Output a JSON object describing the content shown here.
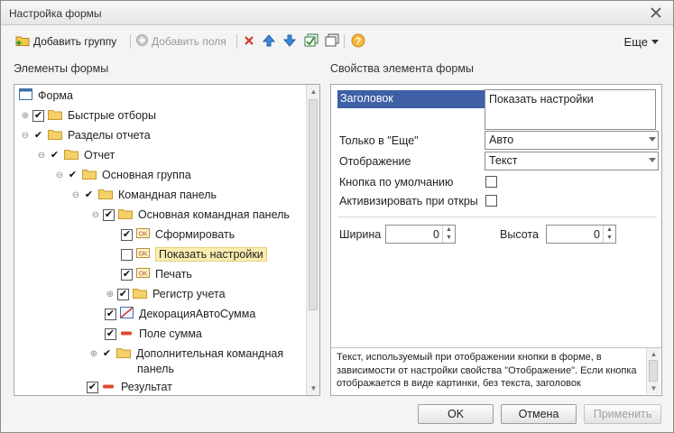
{
  "window": {
    "title": "Настройка формы"
  },
  "toolbar": {
    "add_group": "Добавить группу",
    "add_fields": "Добавить поля",
    "more": "Еще"
  },
  "left_panel": {
    "title": "Элементы формы"
  },
  "right_panel": {
    "title": "Свойства элемента формы"
  },
  "tree": {
    "items": [
      {
        "label": "Форма"
      },
      {
        "label": "Быстрые отборы"
      },
      {
        "label": "Разделы отчета"
      },
      {
        "label": "Отчет"
      },
      {
        "label": "Основная группа"
      },
      {
        "label": "Командная панель"
      },
      {
        "label": "Основная командная панель"
      },
      {
        "label": "Сформировать"
      },
      {
        "label": "Показать настройки"
      },
      {
        "label": "Печать"
      },
      {
        "label": "Регистр учета"
      },
      {
        "label": "ДекорацияАвтоСумма"
      },
      {
        "label": "Поле сумма"
      },
      {
        "label": "Дополнительная командная"
      },
      {
        "label": "панель"
      },
      {
        "label": "Результат"
      }
    ]
  },
  "properties": {
    "title_label": "Заголовок",
    "title_value": "Показать настройки",
    "only_more_label": "Только в \"Еще\"",
    "only_more_value": "Авто",
    "display_label": "Отображение",
    "display_value": "Текст",
    "default_button_label": "Кнопка по умолчанию",
    "activate_label": "Активизировать при откры",
    "width_label": "Ширина",
    "width_value": "0",
    "height_label": "Высота",
    "height_value": "0",
    "description": "Текст, используемый при отображении кнопки в форме, в зависимости от настройки свойства \"Отображение\". Если кнопка отображается в виде картинки, без текста, заголовок"
  },
  "buttons": {
    "ok": "OK",
    "cancel": "Отмена",
    "apply": "Применить"
  },
  "colors": {
    "selection": "#3f5fa6",
    "highlight": "#fbedb0"
  }
}
